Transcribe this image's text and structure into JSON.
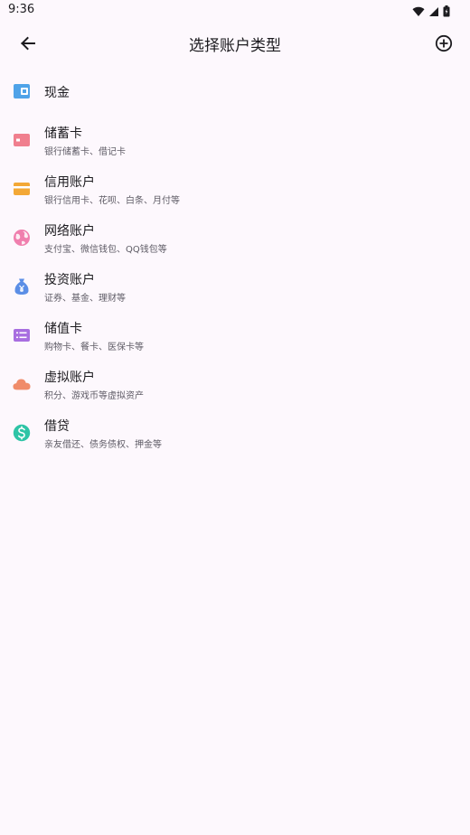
{
  "status_bar": {
    "time": "9:36",
    "icons": [
      "wifi-icon",
      "signal-icon",
      "battery-icon"
    ]
  },
  "app_bar": {
    "title": "选择账户类型",
    "back_icon": "arrow-back-icon",
    "add_icon": "add-circle-icon"
  },
  "account_types": [
    {
      "title": "现金",
      "subtitle": "",
      "icon": "wallet-icon",
      "color": "#4fa3e8"
    },
    {
      "title": "储蓄卡",
      "subtitle": "银行储蓄卡、借记卡",
      "icon": "debit-card-icon",
      "color": "#f07f8e"
    },
    {
      "title": "信用账户",
      "subtitle": "银行信用卡、花呗、白条、月付等",
      "icon": "credit-card-icon",
      "color": "#f3a836"
    },
    {
      "title": "网络账户",
      "subtitle": "支付宝、微信钱包、QQ钱包等",
      "icon": "globe-icon",
      "color": "#f07fae"
    },
    {
      "title": "投资账户",
      "subtitle": "证券、基金、理财等",
      "icon": "money-bag-icon",
      "color": "#5b8ee6"
    },
    {
      "title": "储值卡",
      "subtitle": "购物卡、餐卡、医保卡等",
      "icon": "stored-value-card-icon",
      "color": "#a86ee0"
    },
    {
      "title": "虚拟账户",
      "subtitle": "积分、游戏币等虚拟资产",
      "icon": "cloud-icon",
      "color": "#f08c6a"
    },
    {
      "title": "借贷",
      "subtitle": "亲友借还、债务债权、押金等",
      "icon": "dollar-circle-icon",
      "color": "#2ec4a6"
    }
  ]
}
